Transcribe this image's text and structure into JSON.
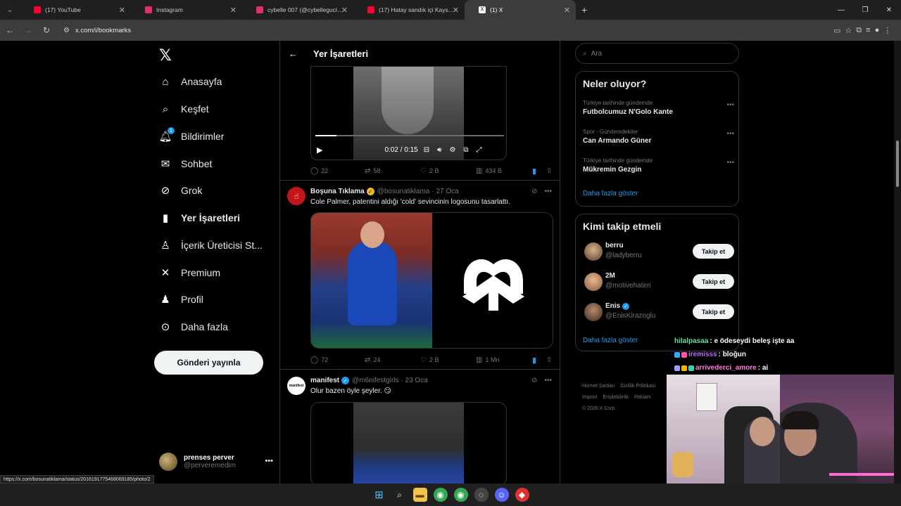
{
  "browser": {
    "tabs": [
      {
        "title": "(17) YouTube",
        "color": "#ff0033"
      },
      {
        "title": "Instagram",
        "color": "#e1306c"
      },
      {
        "title": "cybelle 007 (@cybellegucluer) •",
        "color": "#e1306c"
      },
      {
        "title": "(17) Hatay sandık içi Kayseri'de",
        "color": "#ff0033"
      },
      {
        "title": "(1) X",
        "color": "#ffffff"
      }
    ],
    "url": "x.com/i/bookmarks",
    "status_url": "https://x.com/bosunatiklama/status/2016191775468069185/photo/2"
  },
  "nav": {
    "items": [
      {
        "label": "Anasayfa",
        "icon": "home-icon"
      },
      {
        "label": "Keşfet",
        "icon": "search-icon"
      },
      {
        "label": "Bildirimler",
        "icon": "bell-icon"
      },
      {
        "label": "Sohbet",
        "icon": "mail-icon"
      },
      {
        "label": "Grok",
        "icon": "grok-icon"
      },
      {
        "label": "Yer İşaretleri",
        "icon": "bookmark-icon"
      },
      {
        "label": "İçerik Üreticisi St...",
        "icon": "creator-icon"
      },
      {
        "label": "Premium",
        "icon": "x-icon"
      },
      {
        "label": "Profil",
        "icon": "person-icon"
      },
      {
        "label": "Daha fazla",
        "icon": "more-circle-icon"
      }
    ],
    "notification_count": "1",
    "post_button": "Gönderi yayınla",
    "me": {
      "name": "prenses perver",
      "handle": "@perveremedim"
    }
  },
  "feed": {
    "title": "Yer İşaretleri",
    "video_time": "0:02 / 0:15",
    "tweet0_stats": {
      "replies": "22",
      "reposts": "58",
      "likes": "2 B",
      "views": "434 B"
    },
    "tweet1": {
      "name": "Boşuna Tıklama",
      "handle": "@bosunatiklama",
      "date": "· 27 Oca",
      "text": "Cole Palmer, patentini aldığı 'cold' sevincinin logosunu tasarlattı.",
      "stats": {
        "replies": "72",
        "reposts": "24",
        "likes": "2 B",
        "views": "1 Mn"
      }
    },
    "tweet2": {
      "name": "manifest",
      "handle": "@m6nifestgirls",
      "date": "· 23 Oca",
      "text": "Olur bazen öyle şeyler. 😏",
      "avatar_text": "manifest"
    }
  },
  "right": {
    "search_placeholder": "Ara",
    "trends_title": "Neler oluyor?",
    "trends": [
      {
        "context": "Türkiye tarihinde gündemde",
        "name": "Futbolcumuz N'Golo Kante"
      },
      {
        "context": "Spor · Gündemdekiler",
        "name": "Can Armando Güner"
      },
      {
        "context": "Türkiye tarihinde gündemde",
        "name": "Mükremin Gezgin"
      }
    ],
    "show_more": "Daha fazla göster",
    "wtf_title": "Kimi takip etmeli",
    "wtf": [
      {
        "name": "berru",
        "handle": "@ladyberru",
        "verified": false
      },
      {
        "name": "2M",
        "handle": "@motivehateri",
        "verified": false
      },
      {
        "name": "Enis",
        "handle": "@EnisKirazoglu",
        "verified": true
      }
    ],
    "follow_label": "Takip et",
    "footer": [
      "Hizmet Şartları",
      "Gizlilik Politikası",
      "Imprint",
      "Erişilebilirlik",
      "Reklam",
      "© 2026 X Corp."
    ]
  },
  "chat": [
    {
      "user": "hilalpasaa",
      "text": ": e ödeseydi beleş işte aa",
      "color": "#5fe0a0"
    },
    {
      "user": "iremisss",
      "text": ": bloğun",
      "color": "#b46cff"
    },
    {
      "user": "arrivederci_amore",
      "text": ": ai",
      "color": "#ff7ad9"
    }
  ]
}
